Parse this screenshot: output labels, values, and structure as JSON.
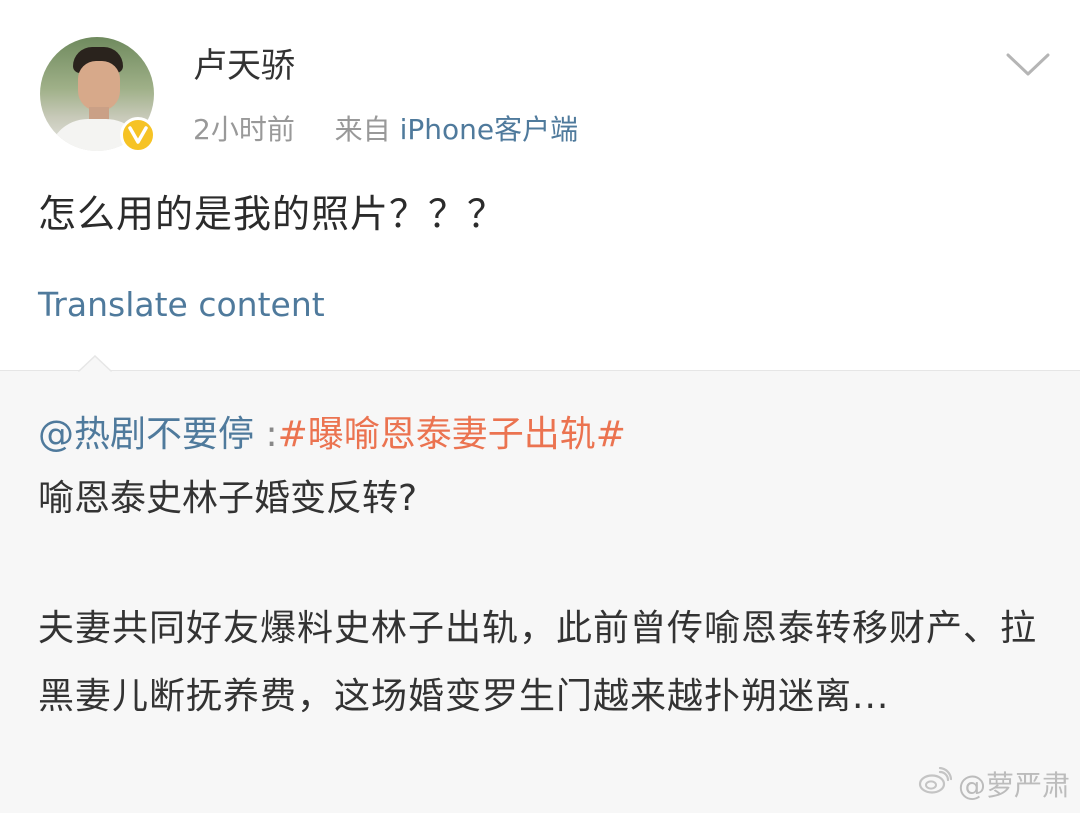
{
  "post": {
    "author": "卢天骄",
    "time": "2小时前",
    "source_prefix": "来自",
    "source": "iPhone客户端",
    "text": "怎么用的是我的照片？？？",
    "translate_label": "Translate content",
    "avatar_icon": "user-avatar-photo",
    "badge_icon": "verified-badge-icon",
    "menu_icon": "chevron-down-icon"
  },
  "repost": {
    "mention": "@热剧不要停",
    "colon": " :",
    "hashtag": "#曝喻恩泰妻子出轨#",
    "subtitle": "喻恩泰史林子婚变反转?",
    "body": "夫妻共同好友爆料史林子出轨，此前曾传喻恩泰转移财产、拉黑妻儿断抚养费，这场婚变罗生门越来越扑朔迷离..."
  },
  "watermark": {
    "text": "@萝严肃",
    "icon": "weibo-logo-icon"
  },
  "colors": {
    "link_blue": "#4f7a9c",
    "hashtag_orange": "#eb7350",
    "badge_yellow": "#f6c325",
    "repost_bg": "#f7f7f7"
  }
}
